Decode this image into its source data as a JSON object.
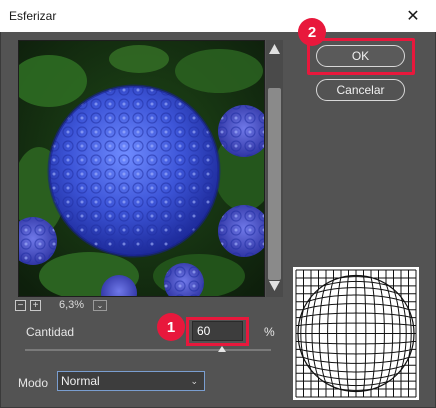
{
  "window": {
    "title": "Esferizar",
    "close_glyph": "✕"
  },
  "preview": {
    "image_subject": "blue hydrangea",
    "zoom_out_glyph": "−",
    "zoom_in_glyph": "+",
    "zoom_value": "6,3%",
    "zoom_drop_glyph": "⌄"
  },
  "buttons": {
    "ok_label": "OK",
    "cancel_label": "Cancelar"
  },
  "callouts": {
    "badge_1": "1",
    "badge_2": "2",
    "color": "#e8183c"
  },
  "amount": {
    "label": "Cantidad",
    "value": "60",
    "unit": "%",
    "slider_level": 0.8
  },
  "mode": {
    "label": "Modo",
    "selected": "Normal",
    "chevron": "⌄"
  },
  "colors": {
    "dialog_bg": "#535353",
    "field_bg": "#3d3d3d",
    "highlight": "#e8183c",
    "focus_border": "#7a9ed0"
  }
}
